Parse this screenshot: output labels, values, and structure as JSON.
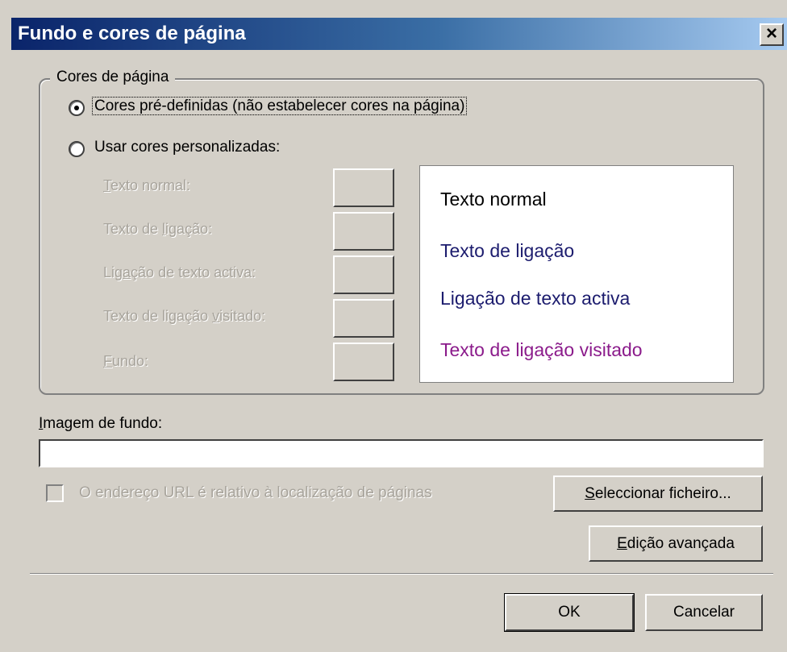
{
  "window": {
    "title": "Fundo e cores de página",
    "close_label": "×"
  },
  "page_colors": {
    "legend": "Cores de página",
    "radio_predefined": "Cores pré-definidas (não estabelecer cores na página)",
    "radio_custom": "Usar cores personalizadas:",
    "selected": "predefined",
    "fields": [
      {
        "label": "Texto normal:",
        "mnemonic": "T"
      },
      {
        "label": "Texto de ligação:",
        "mnemonic": "l"
      },
      {
        "label": "Ligação de texto activa:",
        "mnemonic": "a"
      },
      {
        "label": "Texto de ligação visitado:",
        "mnemonic": "v"
      },
      {
        "label": "Fundo:",
        "mnemonic": "F"
      }
    ],
    "preview": [
      {
        "text": "Texto normal",
        "color": "#000000"
      },
      {
        "text": "Texto de ligação",
        "color": "#1c1c6e"
      },
      {
        "text": "Ligação de texto activa",
        "color": "#1c1c6e"
      },
      {
        "text": "Texto de ligação visitado",
        "color": "#8b1b8b"
      }
    ]
  },
  "background_image": {
    "label": "Imagem de fundo:",
    "value": "",
    "relative_checkbox_label": "O endereço URL é relativo à localização de páginas",
    "relative_checked": false,
    "select_file_button": "Seleccionar ficheiro...",
    "advanced_edit_button": "Edição avançada"
  },
  "footer": {
    "ok_button": "OK",
    "cancel_button": "Cancelar"
  }
}
